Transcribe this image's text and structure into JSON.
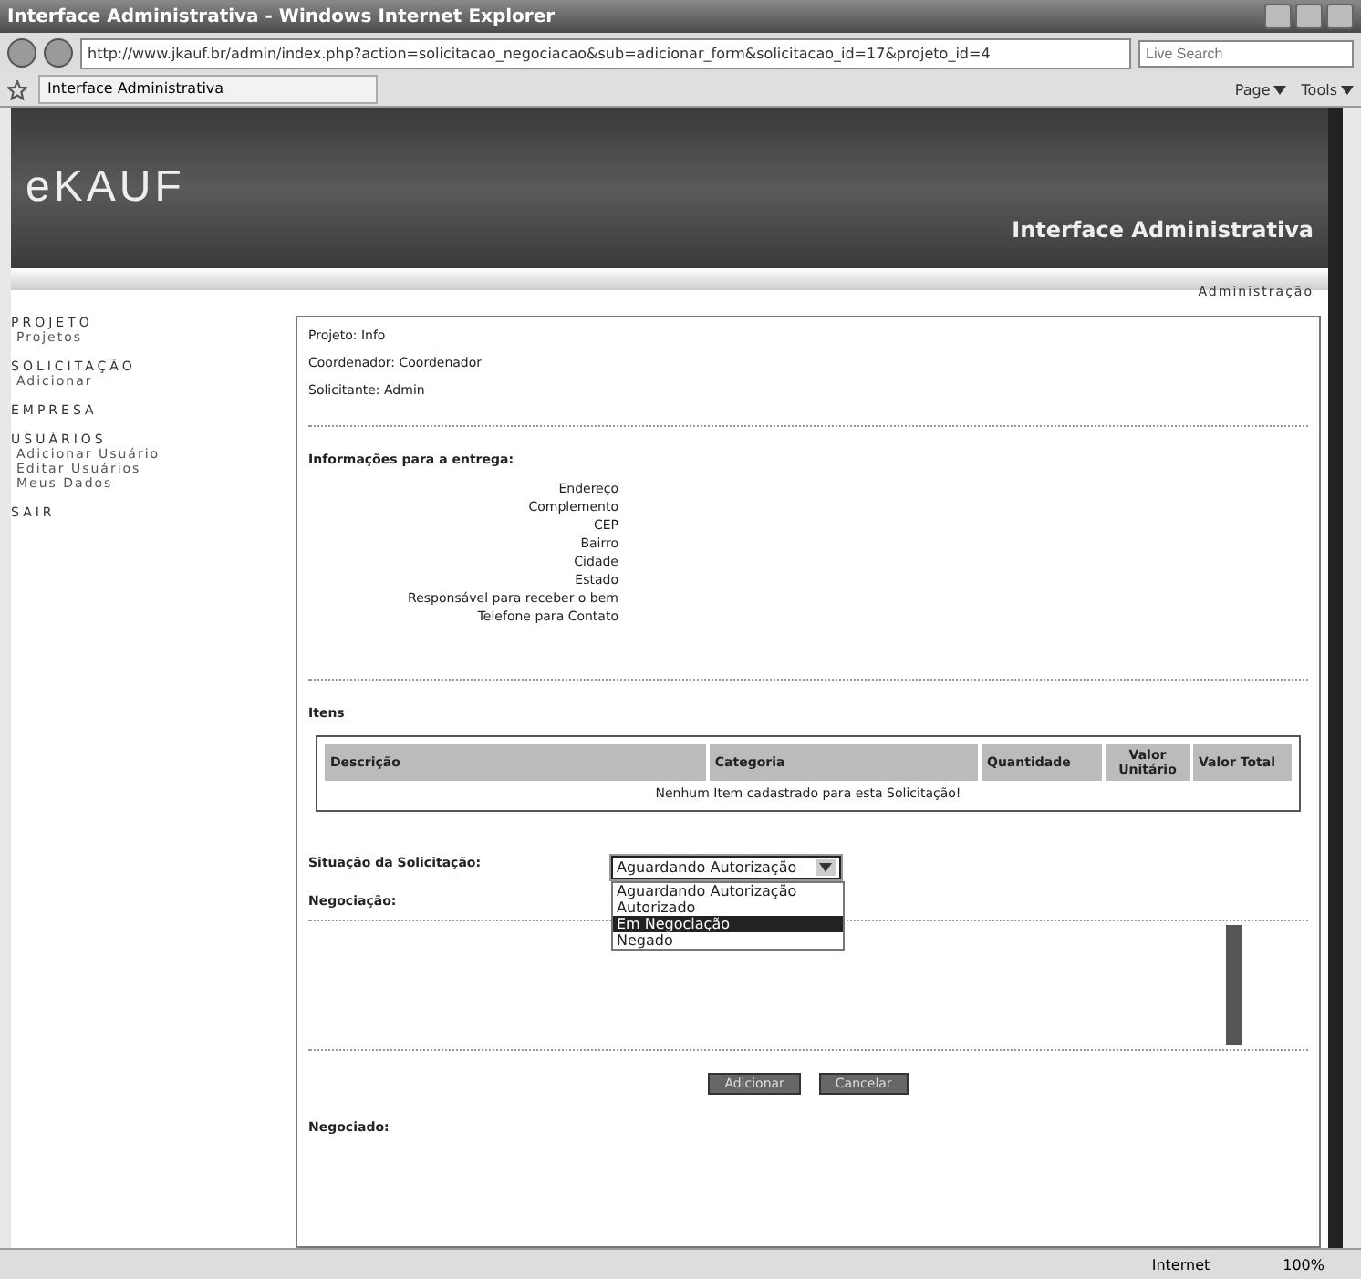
{
  "window": {
    "title": "Interface Administrativa - Windows Internet Explorer",
    "address": "http://www.jkauf.br/admin/index.php?action=solicitacao_negociacao&sub=adicionar_form&solicitacao_id=17&projeto_id=4",
    "search_placeholder": "Live Search",
    "tab_title": "Interface Administrativa",
    "toolbar": [
      "Page",
      "Tools"
    ]
  },
  "header": {
    "logo": "eKAUF",
    "subtitle": "Interface Administrativa",
    "nav": "Administração"
  },
  "sidebar": [
    {
      "heading": "PROJETO",
      "items": [
        "Projetos"
      ]
    },
    {
      "heading": "SOLICITAÇÃO",
      "items": [
        "Adicionar"
      ]
    },
    {
      "heading": "EMPRESA"
    },
    {
      "heading": "USUÁRIOS",
      "items": [
        "Adicionar Usuário",
        "Editar Usuários",
        "Meus Dados"
      ]
    },
    {
      "heading": "SAIR"
    }
  ],
  "info": [
    "Projeto: Info",
    "Coordenador: Coordenador",
    "Solicitante: Admin"
  ],
  "delivery": {
    "title": "Informações para a entrega:",
    "fields": [
      "Endereço",
      "Complemento",
      "CEP",
      "Bairro",
      "Cidade",
      "Estado",
      "Responsável para receber o bem",
      "Telefone para Contato"
    ]
  },
  "items": {
    "title": "Itens",
    "columns": [
      "Descrição",
      "Categoria",
      "Quantidade",
      "Valor Unitário",
      "Valor Total"
    ],
    "empty": "Nenhum Item cadastrado para esta Solicitação!"
  },
  "situation": {
    "label": "Situação da Solicitação:",
    "value": "Aguardando Autorização",
    "expanded": true,
    "options": [
      {
        "label": "Aguardando Autorização",
        "highlighted": false
      },
      {
        "label": "Autorizado",
        "highlighted": false
      },
      {
        "label": "Em Negociação",
        "highlighted": true
      },
      {
        "label": "Negado",
        "highlighted": false
      }
    ]
  },
  "negotiation": {
    "label": "Negociação:",
    "buttons": [
      "Adicionar",
      "Cancelar"
    ],
    "negotiated": "Negociado:"
  },
  "status_bar": {
    "zone": "Internet",
    "zoom": "100%"
  }
}
